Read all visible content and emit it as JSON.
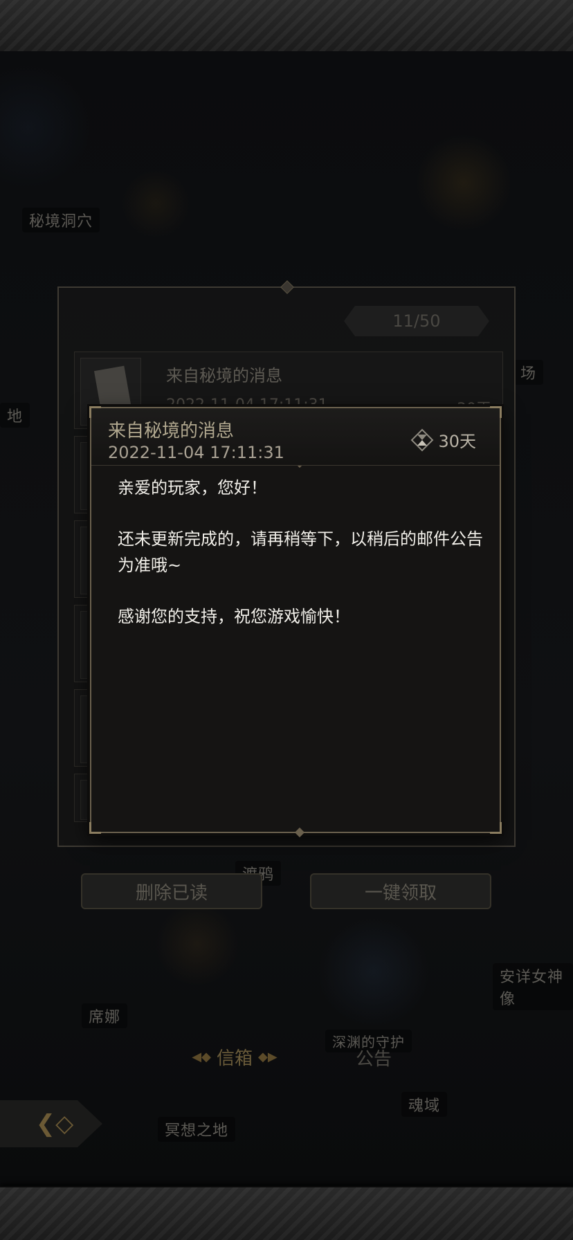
{
  "background": {
    "labels": {
      "secret_cave": "秘境洞穴",
      "left_edge_a": "地",
      "right_edge_a": "场",
      "raven": "渡鸦",
      "sina": "席娜",
      "goddess": "安详女神像",
      "soul_domain": "魂域",
      "meditation": "冥想之地",
      "guardian_partial": "深渊的守护"
    }
  },
  "mailbox": {
    "count": "11/50",
    "rows": [
      {
        "title": "来自秘境的消息",
        "time": "2022-11-04 17:11:31",
        "days": "30天"
      },
      {
        "title": "",
        "time": "",
        "days": ""
      },
      {
        "title": "",
        "time": "",
        "days": ""
      },
      {
        "title": "",
        "time": "",
        "days": ""
      },
      {
        "title": "",
        "time": "",
        "days": ""
      },
      {
        "title": "",
        "time": "",
        "days": ""
      }
    ],
    "delete_read_label": "删除已读",
    "collect_all_label": "一键领取"
  },
  "tabs": {
    "mailbox": "信箱",
    "notice": "公告"
  },
  "detail": {
    "title": "来自秘境的消息",
    "time": "2022-11-04 17:11:31",
    "expire": "30天",
    "body": {
      "greeting": "亲爱的玩家，您好！",
      "line1": "还未更新完成的，请再稍等下，以稍后的邮件公告为准哦~",
      "line2": "感谢您的支持，祝您游戏愉快！"
    }
  },
  "icons": {
    "hourglass": "hourglass-icon",
    "back": "back-diamond-icon"
  },
  "colors": {
    "accent_gold": "#8b7d60",
    "dialog_bg": "#151413",
    "body_text": "#f2f0ea"
  }
}
